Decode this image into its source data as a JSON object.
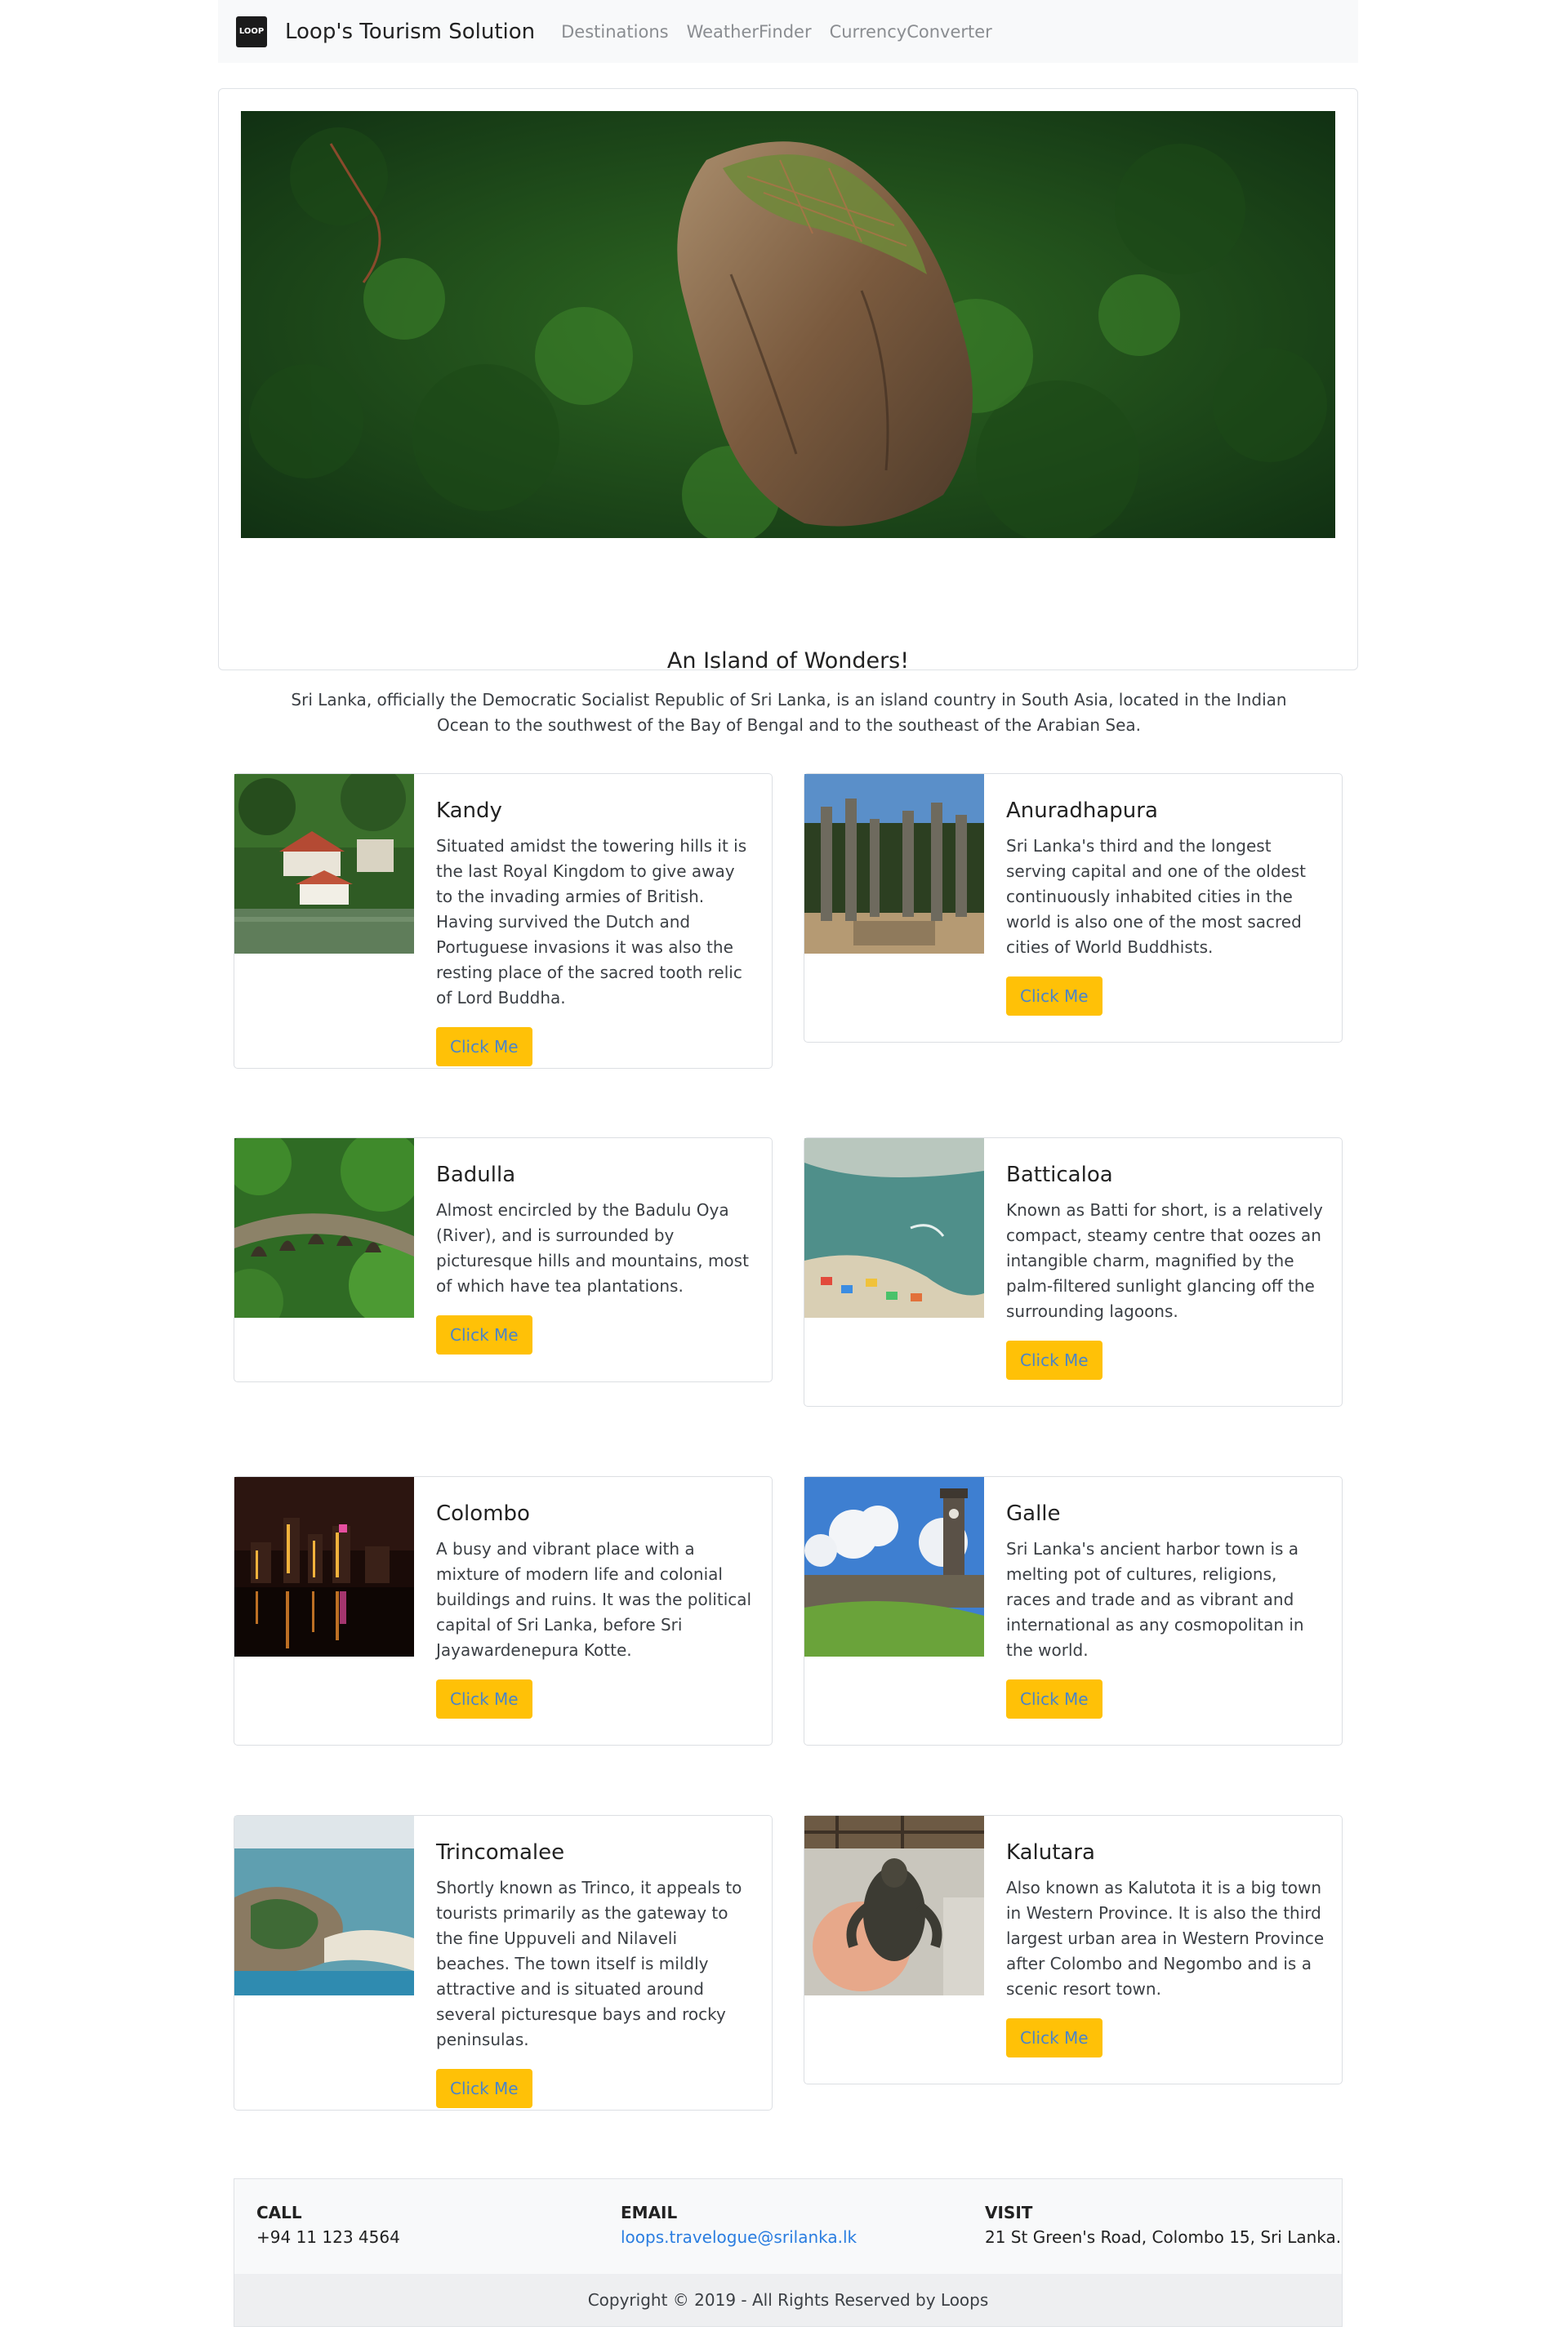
{
  "nav": {
    "brand_logo_text": "LOOP",
    "brand": "Loop's Tourism Solution",
    "links": [
      "Destinations",
      "WeatherFinder",
      "CurrencyConverter"
    ]
  },
  "hero": {
    "title": "An Island of Wonders!",
    "text": "Sri Lanka, officially the Democratic Socialist Republic of Sri Lanka, is an island country in South Asia, located in the Indian Ocean to the southwest of the Bay of Bengal and to the southeast of the Arabian Sea."
  },
  "cards": [
    {
      "title": "Kandy",
      "text": "Situated amidst the towering hills it is the last Royal Kingdom to give away to the invading armies of British. Having survived the Dutch and Portuguese invasions it was also the resting place of the sacred tooth relic of Lord Buddha.",
      "button": "Click Me"
    },
    {
      "title": "Anuradhapura",
      "text": "Sri Lanka's third and the longest serving capital and one of the oldest continuously inhabited cities in the world is also one of the most sacred cities of World Buddhists.",
      "button": "Click Me"
    },
    {
      "title": "Badulla",
      "text": "Almost encircled by the Badulu Oya (River), and is surrounded by picturesque hills and mountains, most of which have tea plantations.",
      "button": "Click Me"
    },
    {
      "title": "Batticaloa",
      "text": "Known as Batti for short, is a relatively compact, steamy centre that oozes an intangible charm, magnified by the palm-filtered sunlight glancing off the surrounding lagoons.",
      "button": "Click Me"
    },
    {
      "title": "Colombo",
      "text": "A busy and vibrant place with a mixture of modern life and colonial buildings and ruins. It was the political capital of Sri Lanka, before Sri Jayawardenepura Kotte.",
      "button": "Click Me"
    },
    {
      "title": "Galle",
      "text": "Sri Lanka's ancient harbor town is a melting pot of cultures, religions, races and trade and as vibrant and international as any cosmopolitan in the world.",
      "button": "Click Me"
    },
    {
      "title": "Trincomalee",
      "text": "Shortly known as Trinco, it appeals to tourists primarily as the gateway to the fine Uppuveli and Nilaveli beaches. The town itself is mildly attractive and is situated around several picturesque bays and rocky peninsulas.",
      "button": "Click Me"
    },
    {
      "title": "Kalutara",
      "text": "Also known as Kalutota it is a big town in Western Province. It is also the third largest urban area in Western Province after Colombo and Negombo and is a scenic resort town.",
      "button": "Click Me"
    }
  ],
  "footer": {
    "call_label": "CALL",
    "call_value": "+94 11 123 4564",
    "email_label": "EMAIL",
    "email_value": "loops.travelogue@srilanka.lk",
    "visit_label": "VISIT",
    "visit_value": "21 St Green's Road, Colombo 15, Sri Lanka.",
    "copyright": "Copyright © 2019 - All Rights Reserved by Loops"
  }
}
